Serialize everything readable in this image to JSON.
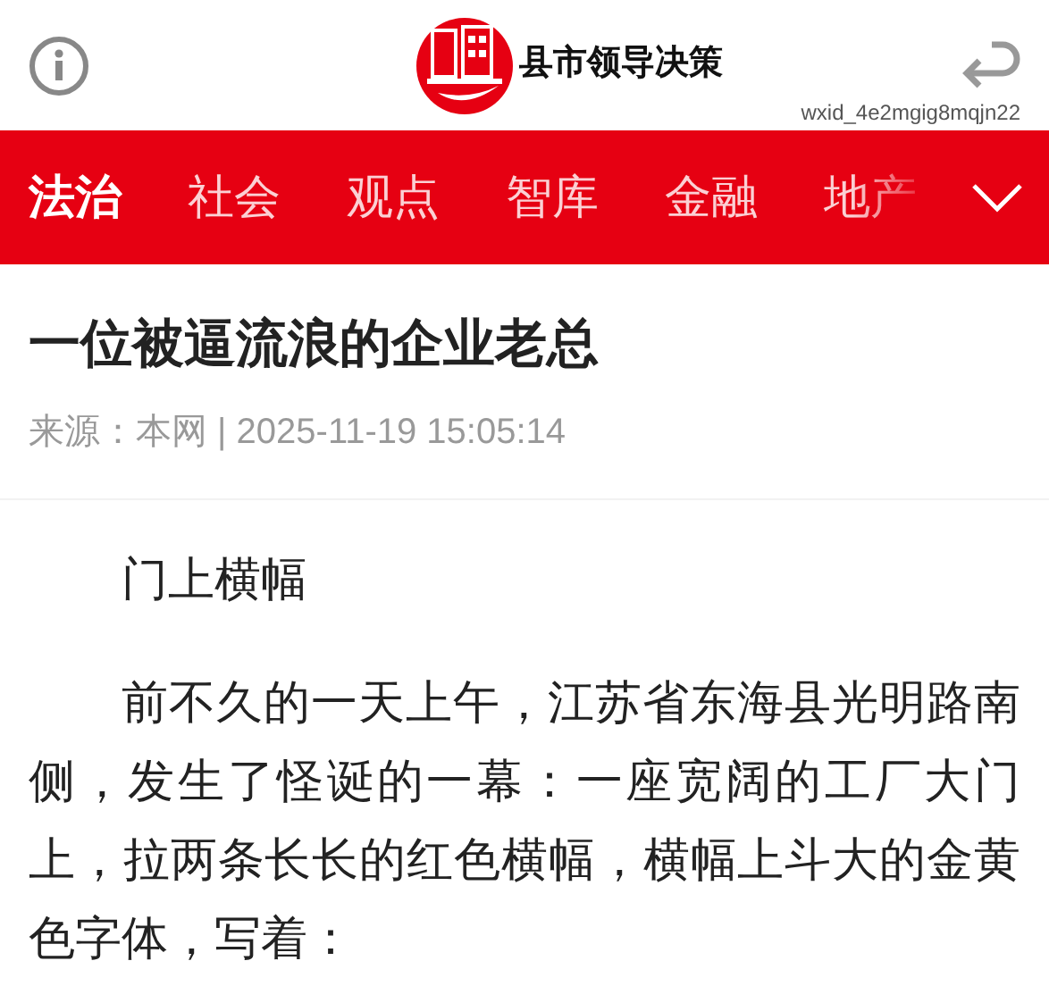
{
  "header": {
    "site_name": "县市领导决策",
    "user_id": "wxid_4e2mgig8mqjn22"
  },
  "tabs": [
    {
      "label": "法治",
      "selected": true
    },
    {
      "label": "社会",
      "selected": false
    },
    {
      "label": "观点",
      "selected": false
    },
    {
      "label": "智库",
      "selected": false
    },
    {
      "label": "金融",
      "selected": false
    },
    {
      "label": "地产",
      "selected": false
    }
  ],
  "article": {
    "title": "一位被逼流浪的企业老总",
    "meta": "来源：本网 | 2025-11-19 15:05:14",
    "paragraphs": [
      "门上横幅",
      "前不久的一天上午，江苏省东海县光明路南侧，发生了怪诞的一幕：一座宽阔的工厂大门上，拉两条长长的红色横幅，横幅上斗大的金黄色字体，写着："
    ]
  }
}
